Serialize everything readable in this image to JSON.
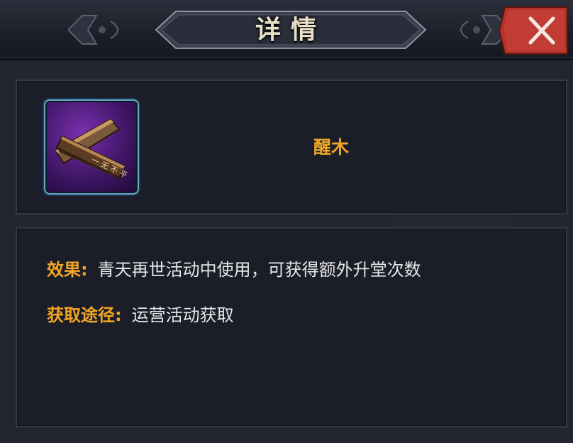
{
  "header": {
    "title": "详情"
  },
  "item": {
    "name": "醒木",
    "icon": "gavel-block-icon"
  },
  "details": {
    "effect_label": "效果:",
    "effect_value": "青天再世活动中使用，可获得额外升堂次数",
    "source_label": "获取途径:",
    "source_value": "运营活动获取"
  },
  "colors": {
    "accent": "#f2a524",
    "close_red": "#b3322a",
    "icon_border": "#6aa7cc"
  }
}
